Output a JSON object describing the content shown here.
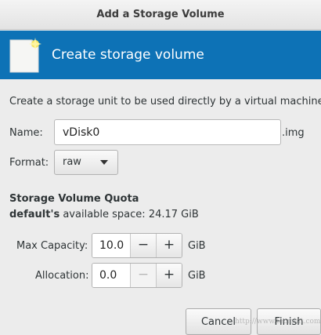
{
  "window": {
    "title": "Add a Storage Volume"
  },
  "banner": {
    "title": "Create storage volume",
    "icon": "new-volume-icon",
    "color": "#0d72b6"
  },
  "description": "Create a storage unit to be used directly by a virtual machine.",
  "name_field": {
    "label": "Name:",
    "value": "vDisk0",
    "suffix": ".img"
  },
  "format_field": {
    "label": "Format:",
    "selected": "raw"
  },
  "quota": {
    "title": "Storage Volume Quota",
    "pool_name": "default's",
    "available_label": "available space:",
    "available_value": "24.17 GiB"
  },
  "max_capacity": {
    "label": "Max Capacity:",
    "value": "10.0",
    "unit": "GiB",
    "minus": "−",
    "plus": "+"
  },
  "allocation": {
    "label": "Allocation:",
    "value": "0.0",
    "unit": "GiB",
    "minus": "−",
    "plus": "+"
  },
  "buttons": {
    "cancel": "Cancel",
    "finish": "Finish"
  },
  "watermark": "http://www.tecmint.com"
}
